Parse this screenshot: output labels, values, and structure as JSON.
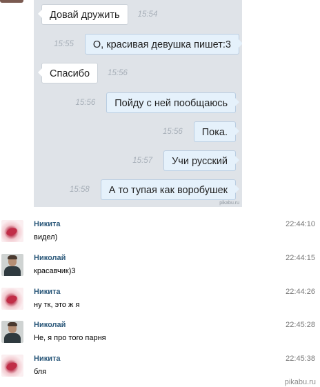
{
  "screenshot": {
    "messages": [
      {
        "direction": "in",
        "text": "Довай дружить",
        "time": "15:54"
      },
      {
        "direction": "out",
        "text": "О, красивая девушка пишет:3",
        "time": "15:55"
      },
      {
        "direction": "in",
        "text": "Спасибо",
        "time": "15:56"
      },
      {
        "direction": "out",
        "text": "Пойду с ней пообщаюсь",
        "time": "15:56"
      },
      {
        "direction": "out",
        "text": "Пока.",
        "time": "15:56"
      },
      {
        "direction": "out",
        "text": "Учи русский",
        "time": "15:57"
      },
      {
        "direction": "out",
        "text": "А то тупая как воробушек",
        "time": "15:58"
      }
    ],
    "watermark": "pikabu.ru"
  },
  "comments": [
    {
      "author": "Никита",
      "time": "22:44:10",
      "text": "видел)",
      "avatar": "pink-avatar"
    },
    {
      "author": "Николай",
      "time": "22:44:15",
      "text": "красавчик)3",
      "avatar": "man-avatar"
    },
    {
      "author": "Никита",
      "time": "22:44:26",
      "text": "ну тк, это ж я",
      "avatar": "pink-avatar"
    },
    {
      "author": "Николай",
      "time": "22:45:28",
      "text": "Не, я про того парня",
      "avatar": "man-avatar"
    },
    {
      "author": "Никита",
      "time": "22:45:38",
      "text": "бля",
      "avatar": "pink-avatar"
    }
  ],
  "footer_watermark": "pikabu.ru",
  "colors": {
    "author": "#2b587a",
    "bubble_out": "#e5f1fb",
    "chat_bg": "#dfe3e8"
  }
}
